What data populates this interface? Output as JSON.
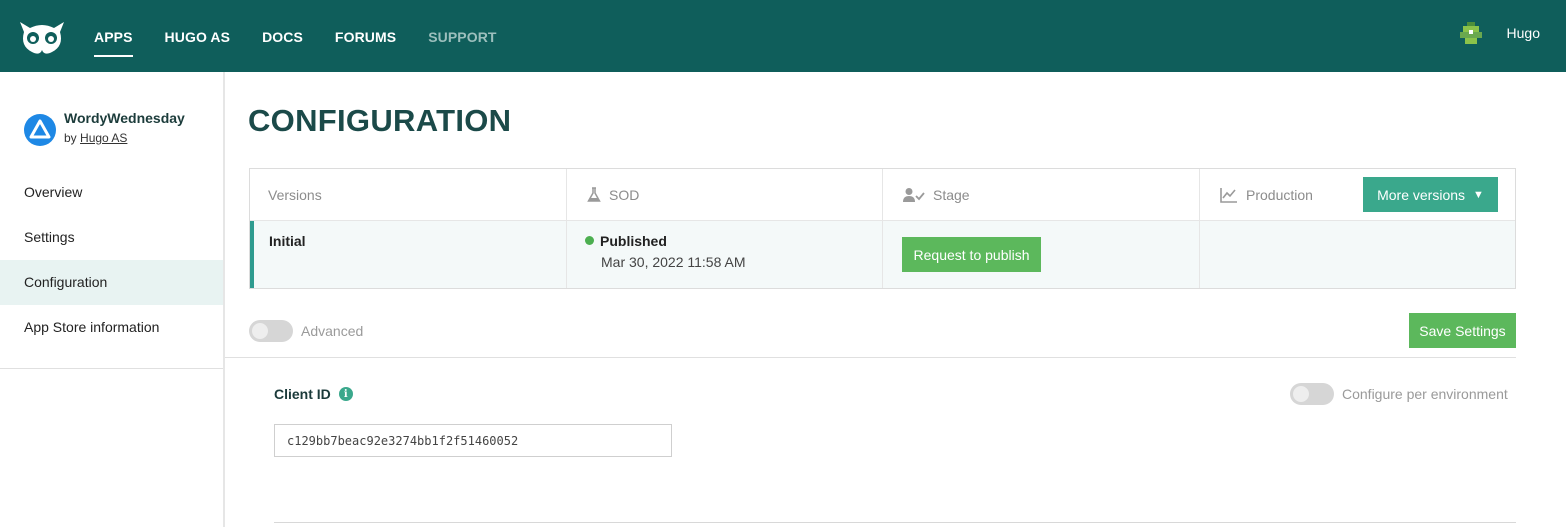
{
  "topbar": {
    "nav": [
      {
        "label": "APPS",
        "active": true
      },
      {
        "label": "HUGO AS",
        "active": false
      },
      {
        "label": "DOCS",
        "active": false
      },
      {
        "label": "FORUMS",
        "active": false
      },
      {
        "label": "SUPPORT",
        "active": false,
        "muted": true
      }
    ],
    "user_name": "Hugo",
    "logo_icon": "owl-logo-icon",
    "avatar_icon": "pixel-avatar-icon"
  },
  "sidebar": {
    "app_name": "WordyWednesday",
    "by_prefix": "by",
    "by_author": "Hugo AS",
    "items": [
      {
        "label": "Overview"
      },
      {
        "label": "Settings"
      },
      {
        "label": "Configuration",
        "active": true
      },
      {
        "label": "App Store information"
      }
    ]
  },
  "main": {
    "title": "CONFIGURATION",
    "versions": {
      "headers": {
        "versions": "Versions",
        "sod": "SOD",
        "stage": "Stage",
        "production": "Production"
      },
      "more_versions": "More versions",
      "row": {
        "name": "Initial",
        "status": "Published",
        "date": "Mar 30, 2022 11:58 AM",
        "request_button": "Request to publish"
      }
    },
    "advanced_label": "Advanced",
    "save_button": "Save Settings",
    "client_id": {
      "label": "Client ID",
      "info_glyph": "i",
      "value": "c129bb7beac92e3274bb1f2f51460052",
      "env_label": "Configure per environment"
    }
  },
  "colors": {
    "topbar": "#0f5e5b",
    "accent": "#3aa88c",
    "button_green": "#5cb85c",
    "title": "#1b4a49"
  }
}
